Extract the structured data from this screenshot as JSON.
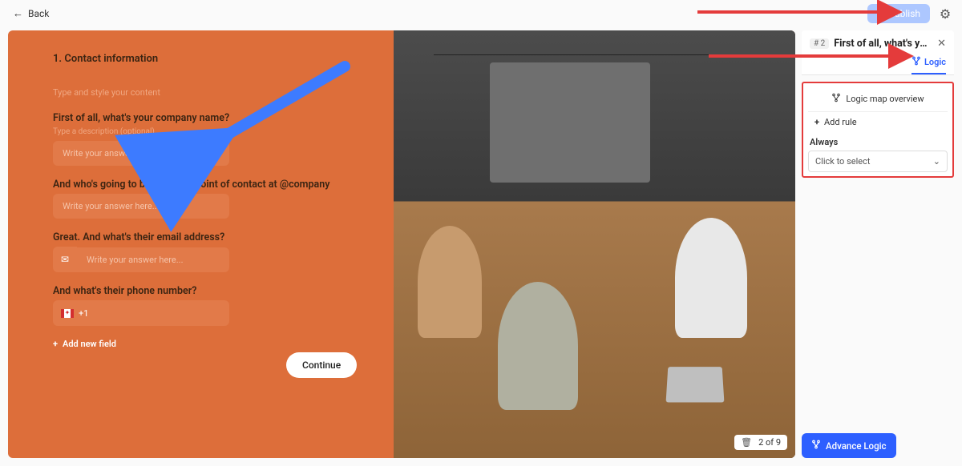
{
  "topbar": {
    "back_label": "Back",
    "publish_label": "Publish"
  },
  "form": {
    "section_title": "1. Contact information",
    "content_hint": "Type and style your content",
    "q1_label": "First of all, what's your company name?",
    "q1_desc": "Type a description (optional)",
    "q1_placeholder": "Write your answer here...",
    "q2_label": "And who's going to be our main point of contact at @company",
    "q2_placeholder": "Write your answer here...",
    "q3_label": "Great. And what's their email address?",
    "q3_placeholder": "Write your answer here...",
    "q4_label": "And what's their phone number?",
    "q4_prefix": "+1",
    "add_field_label": "Add new field",
    "continue_label": "Continue",
    "page_indicator": "2 of 9"
  },
  "sidebar": {
    "chip": "# 2",
    "title": "First of all, what's your c…",
    "logic_tab": "Logic",
    "map_overview": "Logic map overview",
    "add_rule": "Add rule",
    "always_label": "Always",
    "select_placeholder": "Click to select",
    "advance_label": "Advance Logic"
  }
}
